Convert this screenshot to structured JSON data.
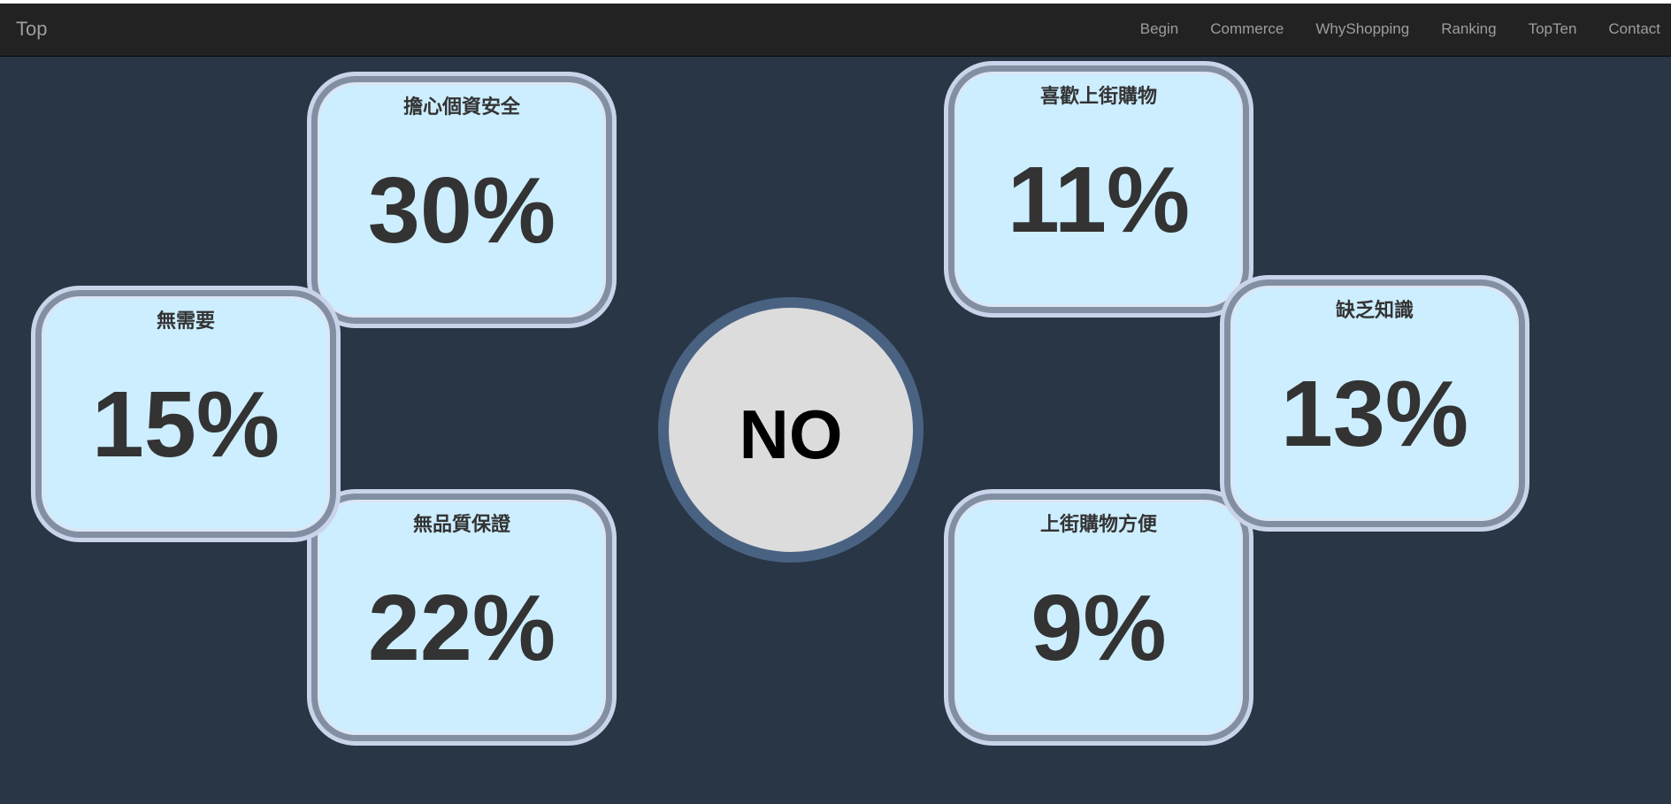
{
  "navbar": {
    "brand": "Top",
    "links": [
      "Begin",
      "Commerce",
      "WhyShopping",
      "Ranking",
      "TopTen",
      "Contact"
    ]
  },
  "center": {
    "label": "NO"
  },
  "cards": [
    {
      "title": "擔心個資安全",
      "value": "30%"
    },
    {
      "title": "無需要",
      "value": "15%"
    },
    {
      "title": "無品質保證",
      "value": "22%"
    },
    {
      "title": "喜歡上街購物",
      "value": "11%"
    },
    {
      "title": "缺乏知識",
      "value": "13%"
    },
    {
      "title": "上街購物方便",
      "value": "9%"
    }
  ],
  "colors": {
    "navbar_bg": "#222222",
    "nav_text": "#9d9d9d",
    "page_bg": "#283645",
    "card_bg": "#cdeeff",
    "card_border": "#828fa3",
    "circle_bg": "#dcdcdc",
    "circle_border": "#4a6282"
  }
}
